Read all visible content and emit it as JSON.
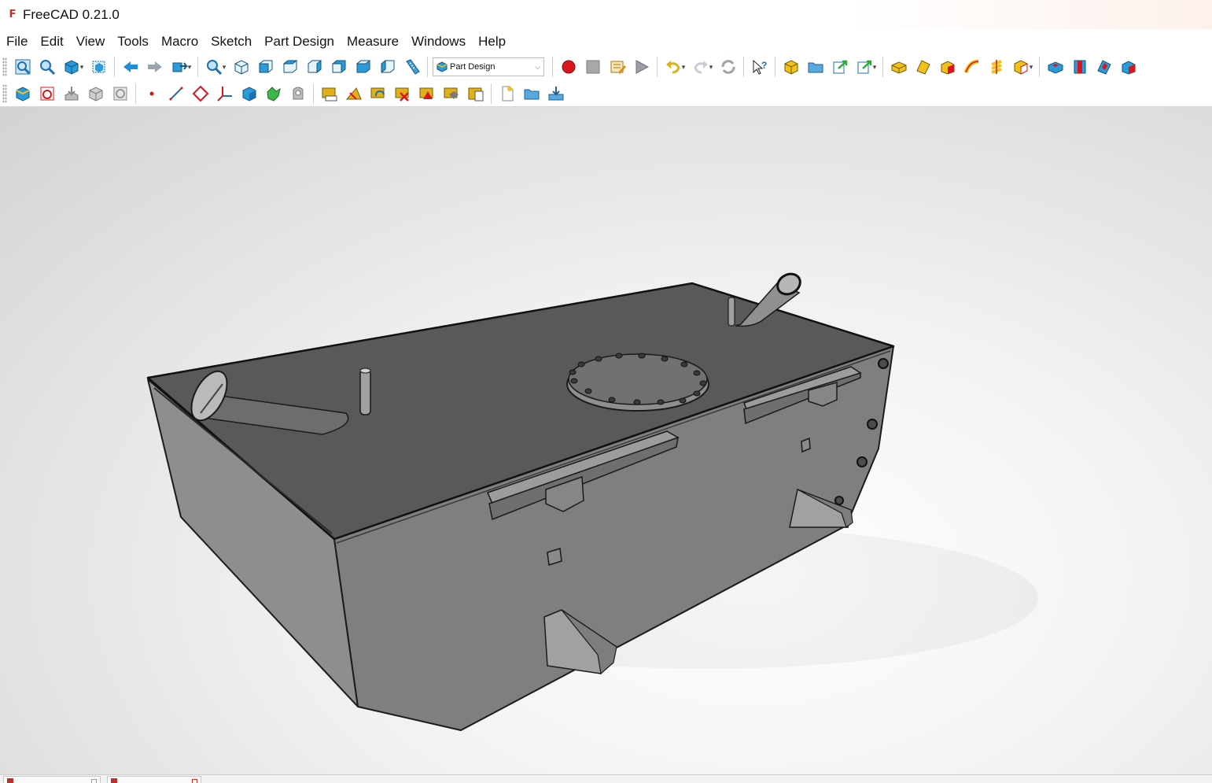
{
  "window": {
    "title": "FreeCAD 0.21.0"
  },
  "menu": [
    "File",
    "Edit",
    "View",
    "Tools",
    "Macro",
    "Sketch",
    "Part Design",
    "Measure",
    "Windows",
    "Help"
  ],
  "workbench_selector": {
    "value": "Part Design"
  },
  "colors": {
    "accent_red": "#c0302a",
    "model_top": "#5a5c5e",
    "model_side_front": "#7e8082",
    "model_side_left": "#8e9092",
    "icon_blue": "#1e8fd8",
    "icon_yellow": "#f2c21c"
  },
  "toolbar_row1": [
    "fit-all-icon",
    "fit-selection-icon",
    "draw-style-icon",
    "bounding-box-icon",
    "back-icon",
    "forward-icon",
    "sync-view-icon",
    "zoom-icon",
    "isometric-view-icon",
    "front-view-icon",
    "top-view-icon",
    "right-view-icon",
    "rear-view-icon",
    "bottom-view-icon",
    "left-view-icon",
    "measure-distance-icon",
    "macro-record-icon",
    "macro-stop-icon",
    "macro-edit-icon",
    "macro-run-icon",
    "undo-icon",
    "redo-icon",
    "refresh-icon",
    "whats-this-icon",
    "create-part-icon",
    "create-group-icon",
    "link-icon",
    "link-actions-icon",
    "pad-icon",
    "revolution-icon",
    "additive-loft-icon",
    "additive-pipe-icon",
    "additive-helix-icon",
    "additive-primitive-icon",
    "pocket-icon",
    "hole-icon",
    "groove-icon",
    "subtractive-loft-icon"
  ],
  "toolbar_row2": [
    "create-body-icon",
    "create-sketch-icon",
    "validate-sketch-icon",
    "shape-binder-icon",
    "clone-icon",
    "datum-point-icon",
    "datum-line-icon",
    "datum-plane-icon",
    "local-coordinate-system-icon",
    "subshape-binder-icon",
    "body-clone-icon",
    "chamfer-icon",
    "measure-linear-icon",
    "measure-angular-icon",
    "measure-refresh-icon",
    "measure-clear-icon",
    "measure-toggle-all-icon",
    "measure-toggle-3d-icon",
    "measure-toggle-delta-icon",
    "new-document-icon",
    "open-document-icon",
    "save-document-icon"
  ]
}
